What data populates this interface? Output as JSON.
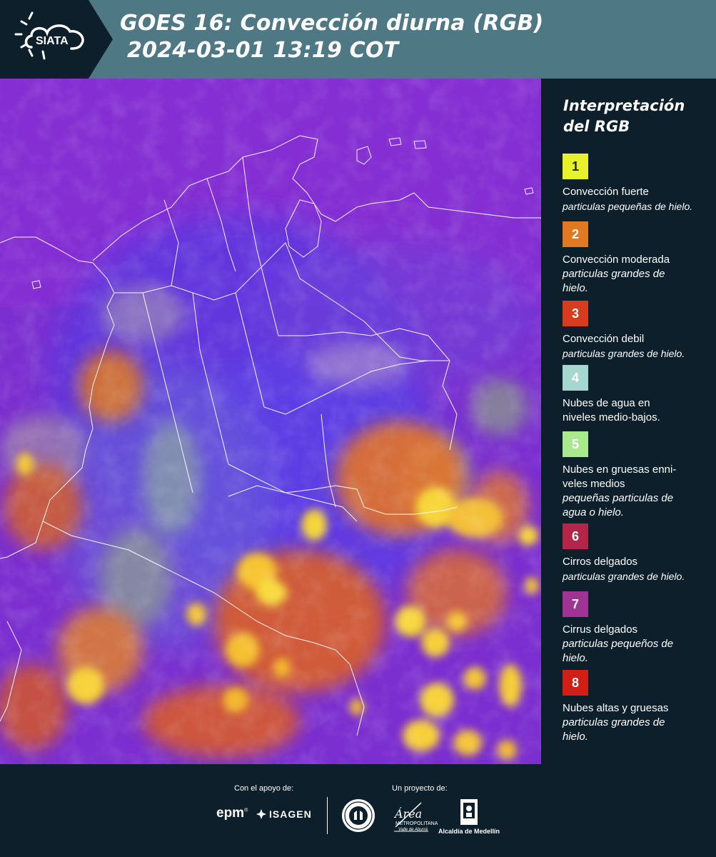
{
  "header": {
    "logo_text": "SIATA",
    "title_line1": "GOES 16: Convección diurna (RGB)",
    "title_line2": "2024-03-01 13:19 COT",
    "background": "#4e7884",
    "logo_background": "#0c1f2b"
  },
  "map": {
    "base_color": "#7b2fd0",
    "border_color": "#ffffff"
  },
  "legend": {
    "title": "Interpretación del RGB",
    "items": [
      {
        "number": "1",
        "color": "#e8f22a",
        "text_color": "#222222",
        "name": "Convección fuerte",
        "desc": "particulas pequeñas de hielo."
      },
      {
        "number": "2",
        "color": "#e07a22",
        "text_color": "#ffffff",
        "name": "Convección moderada",
        "desc": "particulas grandes de hielo."
      },
      {
        "number": "3",
        "color": "#d63c1e",
        "text_color": "#ffffff",
        "name": "Convección debil",
        "desc": "particulas grandes de hielo."
      },
      {
        "number": "4",
        "color": "#a6d6d0",
        "text_color": "#ffffff",
        "name": "Nubes de agua en niveles medio-bajos.",
        "desc": ""
      },
      {
        "number": "5",
        "color": "#a9ea8e",
        "text_color": "#ffffff",
        "name": "Nubes en gruesas enni-veles medios",
        "desc": "pequeñas particulas de agua o hielo."
      },
      {
        "number": "6",
        "color": "#b3264a",
        "text_color": "#ffffff",
        "name": "Cirros delgados",
        "desc": "particulas grandes de hielo."
      },
      {
        "number": "7",
        "color": "#a03494",
        "text_color": "#ffffff",
        "name": "Cirrus delgados",
        "desc": "particulas pequeños de hielo."
      },
      {
        "number": "8",
        "color": "#cf1f16",
        "text_color": "#ffffff",
        "name": "Nubes altas y gruesas",
        "desc": "particulas grandes de hielo."
      }
    ]
  },
  "footer": {
    "support_label": "Con el apoyo de:",
    "project_label": "Un proyecto de:",
    "epm": "epm",
    "epm_mark": "®",
    "isagen": "ISAGEN",
    "area_name": "Área",
    "area_sub": "METROPOLITANA",
    "area_sub2": "Valle de Aburrá",
    "alcaldia": "Alcaldía de Medellín"
  }
}
